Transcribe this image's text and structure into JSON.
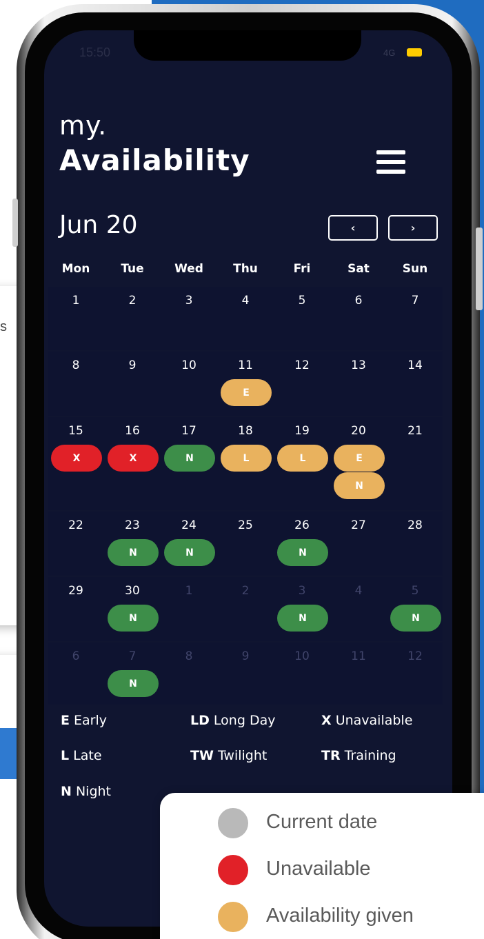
{
  "status_bar": {
    "time": "15:50",
    "network": "4G",
    "icons": [
      "signal-icon",
      "battery-charging-icon"
    ]
  },
  "header": {
    "title_small": "my.",
    "title_big": "Availability",
    "menu_icon": "hamburger-menu-icon"
  },
  "calendar": {
    "month_label": "Jun 20",
    "prev_label": "‹",
    "next_label": "›",
    "weekdays": [
      "Mon",
      "Tue",
      "Wed",
      "Thu",
      "Fri",
      "Sat",
      "Sun"
    ],
    "weeks": [
      [
        {
          "d": "1"
        },
        {
          "d": "2"
        },
        {
          "d": "3"
        },
        {
          "d": "4"
        },
        {
          "d": "5"
        },
        {
          "d": "6"
        },
        {
          "d": "7"
        }
      ],
      [
        {
          "d": "8"
        },
        {
          "d": "9"
        },
        {
          "d": "10"
        },
        {
          "d": "11",
          "shifts": [
            {
              "code": "E",
              "status": "given"
            }
          ]
        },
        {
          "d": "12"
        },
        {
          "d": "13"
        },
        {
          "d": "14"
        }
      ],
      [
        {
          "d": "15",
          "shifts": [
            {
              "code": "X",
              "status": "unavailable"
            }
          ]
        },
        {
          "d": "16",
          "shifts": [
            {
              "code": "X",
              "status": "unavailable"
            }
          ]
        },
        {
          "d": "17",
          "shifts": [
            {
              "code": "N",
              "status": "booked"
            }
          ]
        },
        {
          "d": "18",
          "shifts": [
            {
              "code": "L",
              "status": "given"
            }
          ]
        },
        {
          "d": "19",
          "shifts": [
            {
              "code": "L",
              "status": "given"
            }
          ]
        },
        {
          "d": "20",
          "shifts": [
            {
              "code": "E",
              "status": "given"
            },
            {
              "code": "N",
              "status": "given"
            }
          ]
        },
        {
          "d": "21"
        }
      ],
      [
        {
          "d": "22"
        },
        {
          "d": "23",
          "shifts": [
            {
              "code": "N",
              "status": "booked"
            }
          ]
        },
        {
          "d": "24",
          "shifts": [
            {
              "code": "N",
              "status": "booked"
            }
          ]
        },
        {
          "d": "25"
        },
        {
          "d": "26",
          "shifts": [
            {
              "code": "N",
              "status": "booked"
            }
          ]
        },
        {
          "d": "27"
        },
        {
          "d": "28"
        }
      ],
      [
        {
          "d": "29"
        },
        {
          "d": "30",
          "shifts": [
            {
              "code": "N",
              "status": "booked"
            }
          ]
        },
        {
          "d": "1",
          "dim": true
        },
        {
          "d": "2",
          "dim": true
        },
        {
          "d": "3",
          "dim": true,
          "shifts": [
            {
              "code": "N",
              "status": "booked"
            }
          ]
        },
        {
          "d": "4",
          "dim": true
        },
        {
          "d": "5",
          "dim": true,
          "shifts": [
            {
              "code": "N",
              "status": "booked"
            }
          ]
        }
      ],
      [
        {
          "d": "6",
          "dim": true
        },
        {
          "d": "7",
          "dim": true,
          "shifts": [
            {
              "code": "N",
              "status": "booked"
            }
          ]
        },
        {
          "d": "8",
          "dim": true
        },
        {
          "d": "9",
          "dim": true
        },
        {
          "d": "10",
          "dim": true
        },
        {
          "d": "11",
          "dim": true
        },
        {
          "d": "12",
          "dim": true
        }
      ]
    ]
  },
  "shift_legend": [
    {
      "code": "E",
      "label": "Early"
    },
    {
      "code": "LD",
      "label": "Long Day"
    },
    {
      "code": "X",
      "label": "Unavailable"
    },
    {
      "code": "L",
      "label": "Late"
    },
    {
      "code": "TW",
      "label": "Twilight"
    },
    {
      "code": "TR",
      "label": "Training"
    },
    {
      "code": "N",
      "label": "Night"
    }
  ],
  "status_key": [
    {
      "label": "Current date",
      "color": "#b9b9b9"
    },
    {
      "label": "Unavailable",
      "color": "#e12128"
    },
    {
      "label": "Availability given",
      "color": "#e9b25e"
    }
  ],
  "background_card_text": "s",
  "colors": {
    "screen_bg": "#101530",
    "unavailable": "#e12128",
    "booked": "#3d8e49",
    "given": "#e9b25e",
    "brand_blue": "#1f6cc0"
  }
}
